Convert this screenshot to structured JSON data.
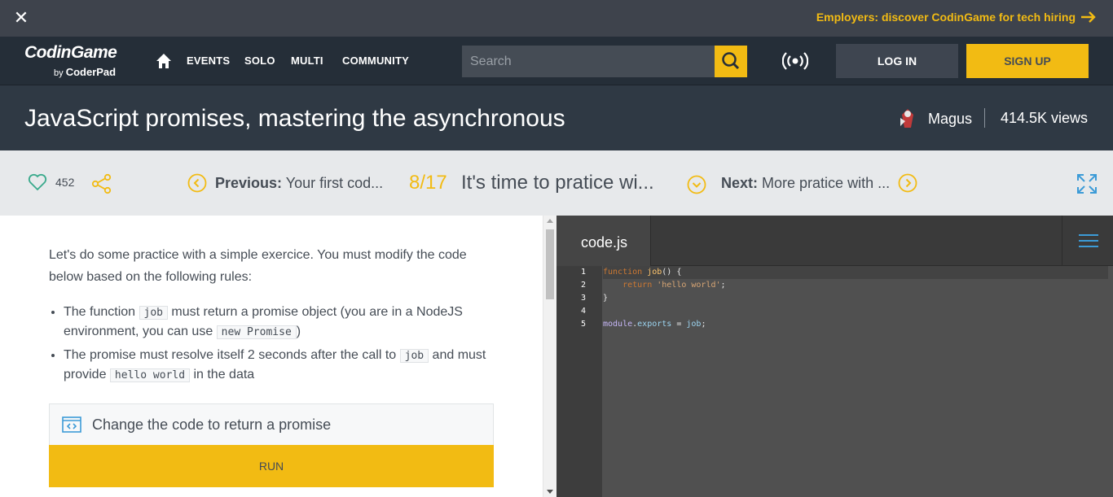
{
  "promo": {
    "employers": "Employers: discover CodinGame for tech hiring"
  },
  "nav": {
    "logo_main": "CodinGame",
    "logo_by": "by",
    "logo_sub": "CoderPad",
    "links": [
      "EVENTS",
      "SOLO",
      "MULTI",
      "COMMUNITY"
    ],
    "search_placeholder": "Search",
    "login": "LOG IN",
    "signup": "SIGN UP"
  },
  "header": {
    "title": "JavaScript promises, mastering the asynchronous",
    "author": "Magus",
    "views": "414.5K views"
  },
  "pager": {
    "likes": "452",
    "prev_label": "Previous:",
    "prev_title": "Your first cod...",
    "counter": "8/17",
    "current_title": "It's time to pratice wi...",
    "next_label": "Next:",
    "next_title": "More pratice with ..."
  },
  "content": {
    "intro": "Let's do some practice with a simple exercice. You must modify the code below based on the following rules:",
    "rule1_a": "The function ",
    "rule1_code1": "job",
    "rule1_b": " must return a promise object (you are in a NodeJS environment, you can use ",
    "rule1_code2": "new Promise",
    "rule1_c": ")",
    "rule2_a": "The promise must resolve itself 2 seconds after the call to ",
    "rule2_code1": "job",
    "rule2_b": " and must provide ",
    "rule2_code2": "hello world",
    "rule2_c": " in the data",
    "exercise_title": "Change the code to return a promise",
    "run_label": "RUN"
  },
  "editor": {
    "tab": "code.js",
    "line_numbers": [
      "1",
      "2",
      "3",
      "4",
      "5"
    ],
    "code": {
      "l1_kw": "function",
      "l1_fn": "job",
      "l1_rest": "() {",
      "l2_indent": "    ",
      "l2_kw": "return",
      "l2_str": "'hello world'",
      "l2_end": ";",
      "l3": "}",
      "l5_mod": "module",
      "l5_dot": ".",
      "l5_prop": "exports",
      "l5_eq": " = ",
      "l5_fn": "job",
      "l5_end": ";"
    }
  },
  "colors": {
    "accent": "#f2bb13",
    "dark_nav": "#252e38",
    "title_bg": "#2f3944",
    "link_blue": "#3c9bd7",
    "green_heart": "#3aaa8c"
  }
}
